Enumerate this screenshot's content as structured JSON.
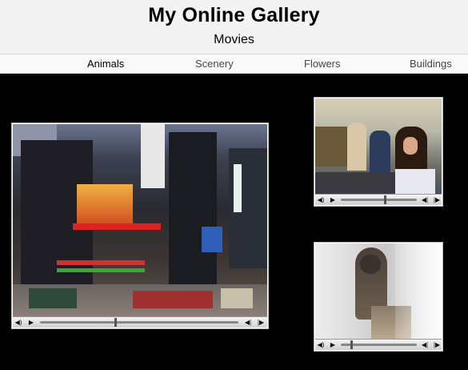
{
  "header": {
    "title": "My Online Gallery",
    "subtitle": "Movies"
  },
  "nav": {
    "items": [
      {
        "label": "Animals",
        "active": true
      },
      {
        "label": "Scenery",
        "active": false
      },
      {
        "label": "Flowers",
        "active": false
      },
      {
        "label": "Buildings",
        "active": false
      }
    ]
  },
  "players": [
    {
      "name": "times-square-movie",
      "progress": 0.5
    },
    {
      "name": "friends-eating-movie",
      "progress": 0.45
    },
    {
      "name": "cat-movie",
      "progress": 0.05
    }
  ],
  "icons": {
    "volume": "speaker-icon",
    "play": "play-icon",
    "step_back": "step-back-icon",
    "step_forward": "step-forward-icon"
  }
}
